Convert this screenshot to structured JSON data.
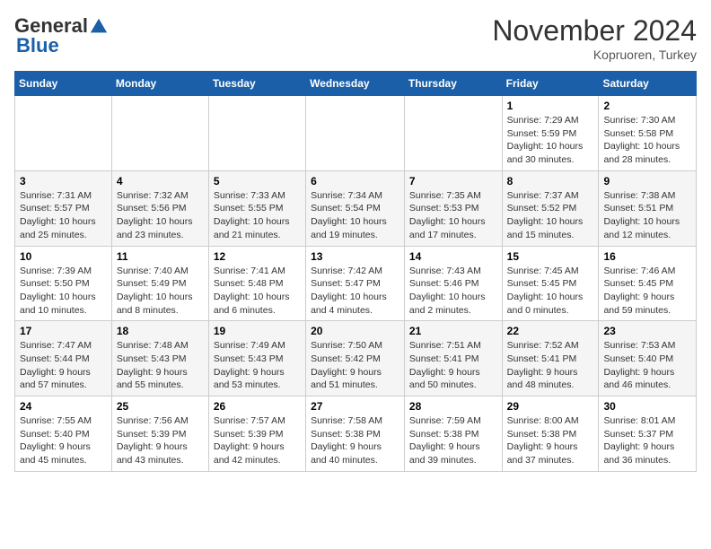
{
  "header": {
    "logo_general": "General",
    "logo_blue": "Blue",
    "month_title": "November 2024",
    "location": "Kopruoren, Turkey"
  },
  "weekdays": [
    "Sunday",
    "Monday",
    "Tuesday",
    "Wednesday",
    "Thursday",
    "Friday",
    "Saturday"
  ],
  "weeks": [
    [
      {
        "day": "",
        "info": ""
      },
      {
        "day": "",
        "info": ""
      },
      {
        "day": "",
        "info": ""
      },
      {
        "day": "",
        "info": ""
      },
      {
        "day": "",
        "info": ""
      },
      {
        "day": "1",
        "info": "Sunrise: 7:29 AM\nSunset: 5:59 PM\nDaylight: 10 hours and 30 minutes."
      },
      {
        "day": "2",
        "info": "Sunrise: 7:30 AM\nSunset: 5:58 PM\nDaylight: 10 hours and 28 minutes."
      }
    ],
    [
      {
        "day": "3",
        "info": "Sunrise: 7:31 AM\nSunset: 5:57 PM\nDaylight: 10 hours and 25 minutes."
      },
      {
        "day": "4",
        "info": "Sunrise: 7:32 AM\nSunset: 5:56 PM\nDaylight: 10 hours and 23 minutes."
      },
      {
        "day": "5",
        "info": "Sunrise: 7:33 AM\nSunset: 5:55 PM\nDaylight: 10 hours and 21 minutes."
      },
      {
        "day": "6",
        "info": "Sunrise: 7:34 AM\nSunset: 5:54 PM\nDaylight: 10 hours and 19 minutes."
      },
      {
        "day": "7",
        "info": "Sunrise: 7:35 AM\nSunset: 5:53 PM\nDaylight: 10 hours and 17 minutes."
      },
      {
        "day": "8",
        "info": "Sunrise: 7:37 AM\nSunset: 5:52 PM\nDaylight: 10 hours and 15 minutes."
      },
      {
        "day": "9",
        "info": "Sunrise: 7:38 AM\nSunset: 5:51 PM\nDaylight: 10 hours and 12 minutes."
      }
    ],
    [
      {
        "day": "10",
        "info": "Sunrise: 7:39 AM\nSunset: 5:50 PM\nDaylight: 10 hours and 10 minutes."
      },
      {
        "day": "11",
        "info": "Sunrise: 7:40 AM\nSunset: 5:49 PM\nDaylight: 10 hours and 8 minutes."
      },
      {
        "day": "12",
        "info": "Sunrise: 7:41 AM\nSunset: 5:48 PM\nDaylight: 10 hours and 6 minutes."
      },
      {
        "day": "13",
        "info": "Sunrise: 7:42 AM\nSunset: 5:47 PM\nDaylight: 10 hours and 4 minutes."
      },
      {
        "day": "14",
        "info": "Sunrise: 7:43 AM\nSunset: 5:46 PM\nDaylight: 10 hours and 2 minutes."
      },
      {
        "day": "15",
        "info": "Sunrise: 7:45 AM\nSunset: 5:45 PM\nDaylight: 10 hours and 0 minutes."
      },
      {
        "day": "16",
        "info": "Sunrise: 7:46 AM\nSunset: 5:45 PM\nDaylight: 9 hours and 59 minutes."
      }
    ],
    [
      {
        "day": "17",
        "info": "Sunrise: 7:47 AM\nSunset: 5:44 PM\nDaylight: 9 hours and 57 minutes."
      },
      {
        "day": "18",
        "info": "Sunrise: 7:48 AM\nSunset: 5:43 PM\nDaylight: 9 hours and 55 minutes."
      },
      {
        "day": "19",
        "info": "Sunrise: 7:49 AM\nSunset: 5:43 PM\nDaylight: 9 hours and 53 minutes."
      },
      {
        "day": "20",
        "info": "Sunrise: 7:50 AM\nSunset: 5:42 PM\nDaylight: 9 hours and 51 minutes."
      },
      {
        "day": "21",
        "info": "Sunrise: 7:51 AM\nSunset: 5:41 PM\nDaylight: 9 hours and 50 minutes."
      },
      {
        "day": "22",
        "info": "Sunrise: 7:52 AM\nSunset: 5:41 PM\nDaylight: 9 hours and 48 minutes."
      },
      {
        "day": "23",
        "info": "Sunrise: 7:53 AM\nSunset: 5:40 PM\nDaylight: 9 hours and 46 minutes."
      }
    ],
    [
      {
        "day": "24",
        "info": "Sunrise: 7:55 AM\nSunset: 5:40 PM\nDaylight: 9 hours and 45 minutes."
      },
      {
        "day": "25",
        "info": "Sunrise: 7:56 AM\nSunset: 5:39 PM\nDaylight: 9 hours and 43 minutes."
      },
      {
        "day": "26",
        "info": "Sunrise: 7:57 AM\nSunset: 5:39 PM\nDaylight: 9 hours and 42 minutes."
      },
      {
        "day": "27",
        "info": "Sunrise: 7:58 AM\nSunset: 5:38 PM\nDaylight: 9 hours and 40 minutes."
      },
      {
        "day": "28",
        "info": "Sunrise: 7:59 AM\nSunset: 5:38 PM\nDaylight: 9 hours and 39 minutes."
      },
      {
        "day": "29",
        "info": "Sunrise: 8:00 AM\nSunset: 5:38 PM\nDaylight: 9 hours and 37 minutes."
      },
      {
        "day": "30",
        "info": "Sunrise: 8:01 AM\nSunset: 5:37 PM\nDaylight: 9 hours and 36 minutes."
      }
    ]
  ]
}
